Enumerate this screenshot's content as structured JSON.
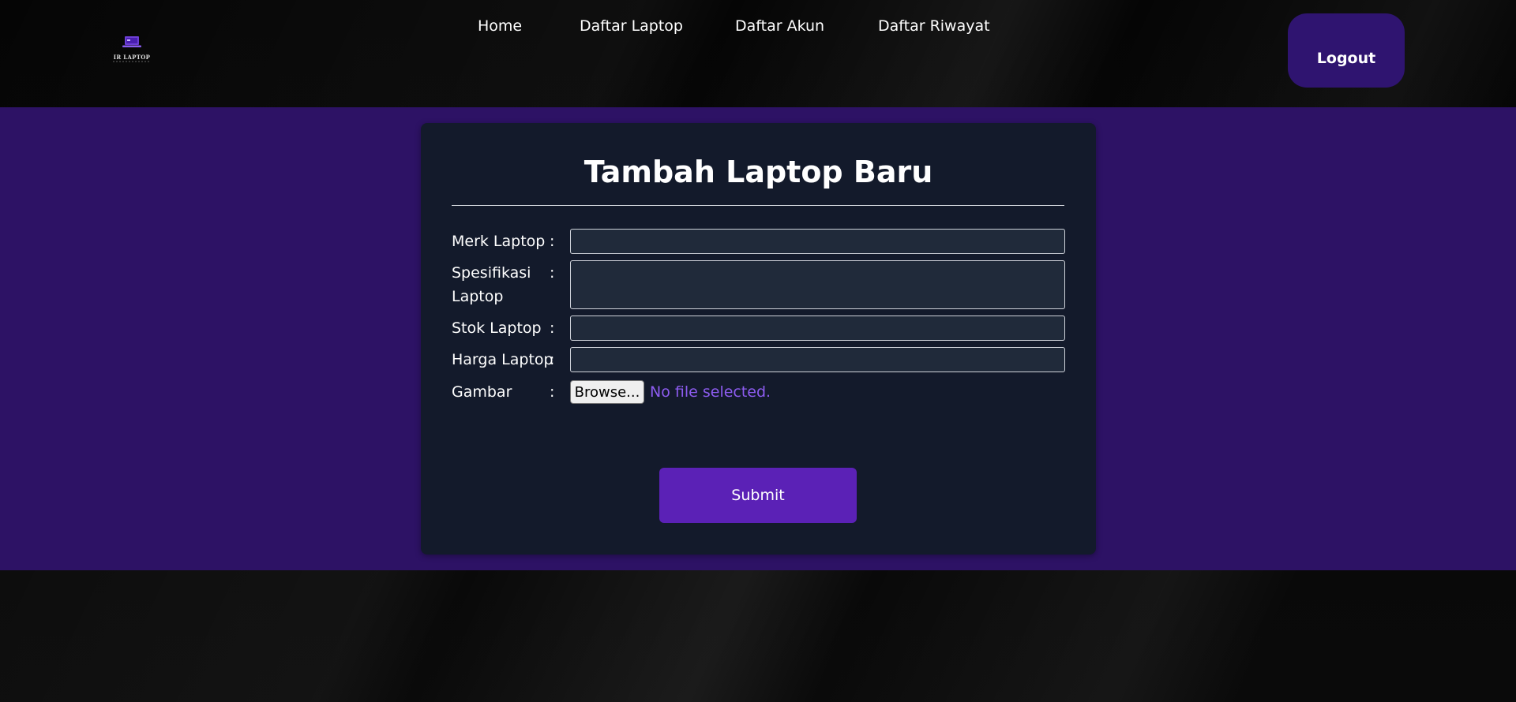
{
  "header": {
    "logo": {
      "icon": "laptop-icon",
      "text": "IR LAPTOP"
    },
    "nav": [
      {
        "label": "Home"
      },
      {
        "label": "Daftar Laptop"
      },
      {
        "label": "Daftar Akun"
      },
      {
        "label": "Daftar Riwayat"
      }
    ],
    "logout_label": "Logout"
  },
  "form": {
    "title": "Tambah Laptop Baru",
    "fields": [
      {
        "label": "Merk Laptop",
        "colon": ":",
        "value": ""
      },
      {
        "label": "Spesifikasi Laptop",
        "colon": ":",
        "value": ""
      },
      {
        "label": "Stok Laptop",
        "colon": ":",
        "value": ""
      },
      {
        "label": "Harga Laptop",
        "colon": ":",
        "value": ""
      },
      {
        "label": "Gambar",
        "colon": ":",
        "browse_label": "Browse...",
        "file_status": "No file selected."
      }
    ],
    "submit_label": "Submit"
  },
  "colors": {
    "band": "#2d1265",
    "card": "#131a2b",
    "field": "#202a3a",
    "accent": "#5b21b6",
    "logout": "#2f1470",
    "file_status": "#8d5cf0"
  }
}
